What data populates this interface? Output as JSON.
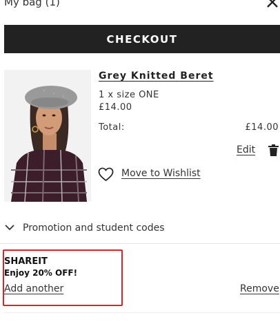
{
  "header": {
    "title": "My bag (1)"
  },
  "checkout": {
    "label": "CHECKOUT"
  },
  "item": {
    "name": "Grey Knitted Beret",
    "qty_size": "1 x size ONE",
    "unit_price": "£14.00",
    "total_label": "Total:",
    "total_value": "£14.00",
    "edit_label": "Edit",
    "wishlist_label": "Move to Wishlist"
  },
  "promo": {
    "toggle_label": "Promotion and student codes",
    "applied_code": "SHAREIT",
    "applied_desc": "Enjoy 20% OFF!",
    "add_another_label": "Add another",
    "remove_label": "Remove"
  },
  "colors": {
    "button_bg": "#222222",
    "highlight_border": "#e02020",
    "text": "#222222"
  },
  "icons": {
    "close": "close-icon",
    "trash": "trash-icon",
    "wishlist": "heart-icon",
    "expand": "chevron-down-icon"
  }
}
